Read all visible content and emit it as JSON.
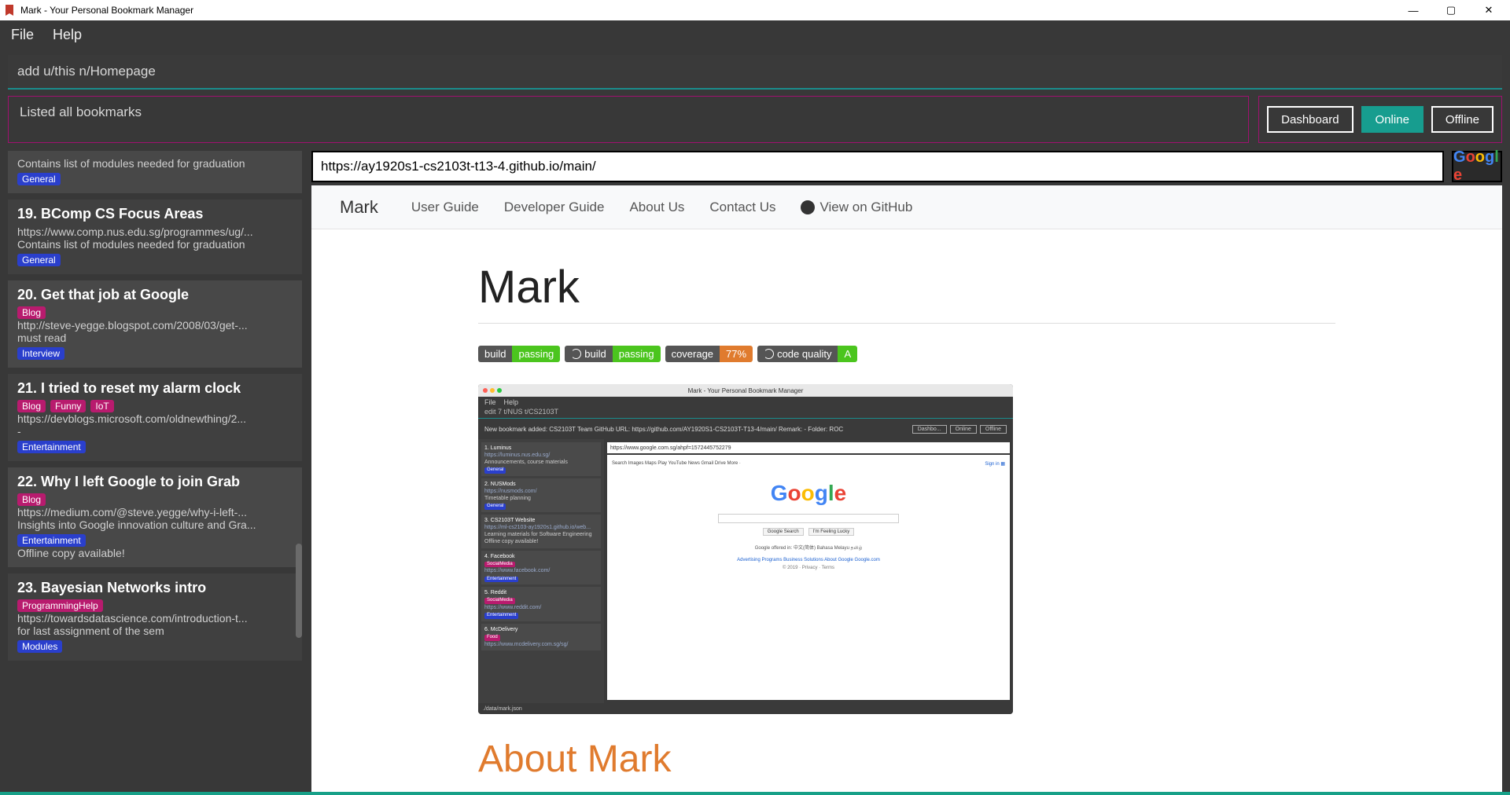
{
  "window": {
    "title": "Mark - Your Personal Bookmark Manager"
  },
  "menu": {
    "file": "File",
    "help": "Help"
  },
  "command": "add u/this n/Homepage",
  "status": "Listed all bookmarks",
  "tabs": {
    "dashboard": "Dashboard",
    "online": "Online",
    "offline": "Offline"
  },
  "url": "https://ay1920s1-cs2103t-t13-4.github.io/main/",
  "bookmarks": [
    {
      "num": "",
      "title": "",
      "desc": "Contains list of modules needed for graduation",
      "url": "",
      "tags": [],
      "folder": "General",
      "offline": ""
    },
    {
      "num": "19.",
      "title": "BComp CS Focus Areas",
      "url": "https://www.comp.nus.edu.sg/programmes/ug/...",
      "desc": "Contains list of modules needed for graduation",
      "tags": [],
      "folder": "General",
      "offline": ""
    },
    {
      "num": "20.",
      "title": "Get that job at Google",
      "url": "http://steve-yegge.blogspot.com/2008/03/get-...",
      "desc": "must read",
      "tags": [
        {
          "t": "Blog",
          "c": "#b81b6e"
        }
      ],
      "folder": "Interview",
      "offline": ""
    },
    {
      "num": "21.",
      "title": "I tried to reset my alarm clock",
      "url": "https://devblogs.microsoft.com/oldnewthing/2...",
      "desc": "-",
      "tags": [
        {
          "t": "Blog",
          "c": "#b81b6e"
        },
        {
          "t": "Funny",
          "c": "#b81b6e"
        },
        {
          "t": "IoT",
          "c": "#b81b6e"
        }
      ],
      "folder": "Entertainment",
      "offline": ""
    },
    {
      "num": "22.",
      "title": "Why I left Google to join Grab",
      "url": "https://medium.com/@steve.yegge/why-i-left-...",
      "desc": "Insights into Google innovation culture and Gra...",
      "tags": [
        {
          "t": "Blog",
          "c": "#b81b6e"
        }
      ],
      "folder": "Entertainment",
      "offline": "Offline copy available!"
    },
    {
      "num": "23.",
      "title": "Bayesian Networks intro",
      "url": "https://towardsdatascience.com/introduction-t...",
      "desc": "for last assignment of the sem",
      "tags": [
        {
          "t": "ProgrammingHelp",
          "c": "#b81b6e"
        }
      ],
      "folder": "Modules",
      "offline": ""
    }
  ],
  "page": {
    "nav": {
      "brand": "Mark",
      "user_guide": "User Guide",
      "dev_guide": "Developer Guide",
      "about": "About Us",
      "contact": "Contact Us",
      "github": "View on GitHub"
    },
    "heading": "Mark",
    "badges": [
      {
        "l": "build",
        "lv": "passing",
        "lc": "#555",
        "rc": "#4bc51e",
        "icon": false
      },
      {
        "l": "build",
        "lv": "passing",
        "lc": "#555",
        "rc": "#4bc51e",
        "icon": true
      },
      {
        "l": "coverage",
        "lv": "77%",
        "lc": "#555",
        "rc": "#e07b2e",
        "icon": false
      },
      {
        "l": "code quality",
        "lv": "A",
        "lc": "#555",
        "rc": "#4bc51e",
        "icon": true
      }
    ],
    "about_heading": "About Mark"
  },
  "shot": {
    "title": "Mark - Your Personal Bookmark Manager",
    "cmd": "edit 7 t/NUS t/CS2103T",
    "status": "New bookmark added: CS2103T Team GitHub URL: https://github.com/AY1920S1-CS2103T-T13-4/main/ Remark: - Folder: ROC",
    "tabs": [
      "Dashbo...",
      "Online",
      "Offline"
    ],
    "url": "https://www.google.com.sg/ahpf=1572445752279",
    "nav": "Search  Images  Maps  Play  YouTube  News  Gmail  Drive  More ·",
    "btns": [
      "Google Search",
      "I'm Feeling Lucky"
    ],
    "offered": "Google offered in: 中文(简体)  Bahasa Melayu  தமிழ்",
    "links": "Advertising Programs   Business Solutions   About Google   Google.com",
    "copy": "© 2019 · Privacy · Terms",
    "bottom": "./data/mark.json",
    "items": [
      {
        "n": "1.",
        "t": "Luminus",
        "u": "https://luminus.nus.edu.sg/",
        "d": "Announcements, course materials",
        "f": "General",
        "fc": "#2a3fcc"
      },
      {
        "n": "2.",
        "t": "NUSMods",
        "u": "https://nusmods.com/",
        "d": "Timetable planning",
        "f": "General",
        "fc": "#2a3fcc"
      },
      {
        "n": "3.",
        "t": "CS2103T Website",
        "u": "https://ml-cs2103-ay1920s1.github.io/web...",
        "d": "Learning materials for Software Engineering",
        "f": "",
        "fc": "",
        "o": "Offline copy available!"
      },
      {
        "n": "4.",
        "t": "Facebook",
        "u": "https://www.facebook.com/",
        "d": "",
        "f": "Entertainment",
        "fc": "#2a3fcc",
        "tg": "SocialMedia"
      },
      {
        "n": "5.",
        "t": "Reddit",
        "u": "https://www.reddit.com/",
        "d": "",
        "f": "Entertainment",
        "fc": "#2a3fcc",
        "tg": "SocialMedia"
      },
      {
        "n": "6.",
        "t": "McDelivery",
        "u": "https://www.mcdelivery.com.sg/sg/",
        "d": "",
        "f": "",
        "fc": "",
        "tg": "Food"
      }
    ]
  }
}
